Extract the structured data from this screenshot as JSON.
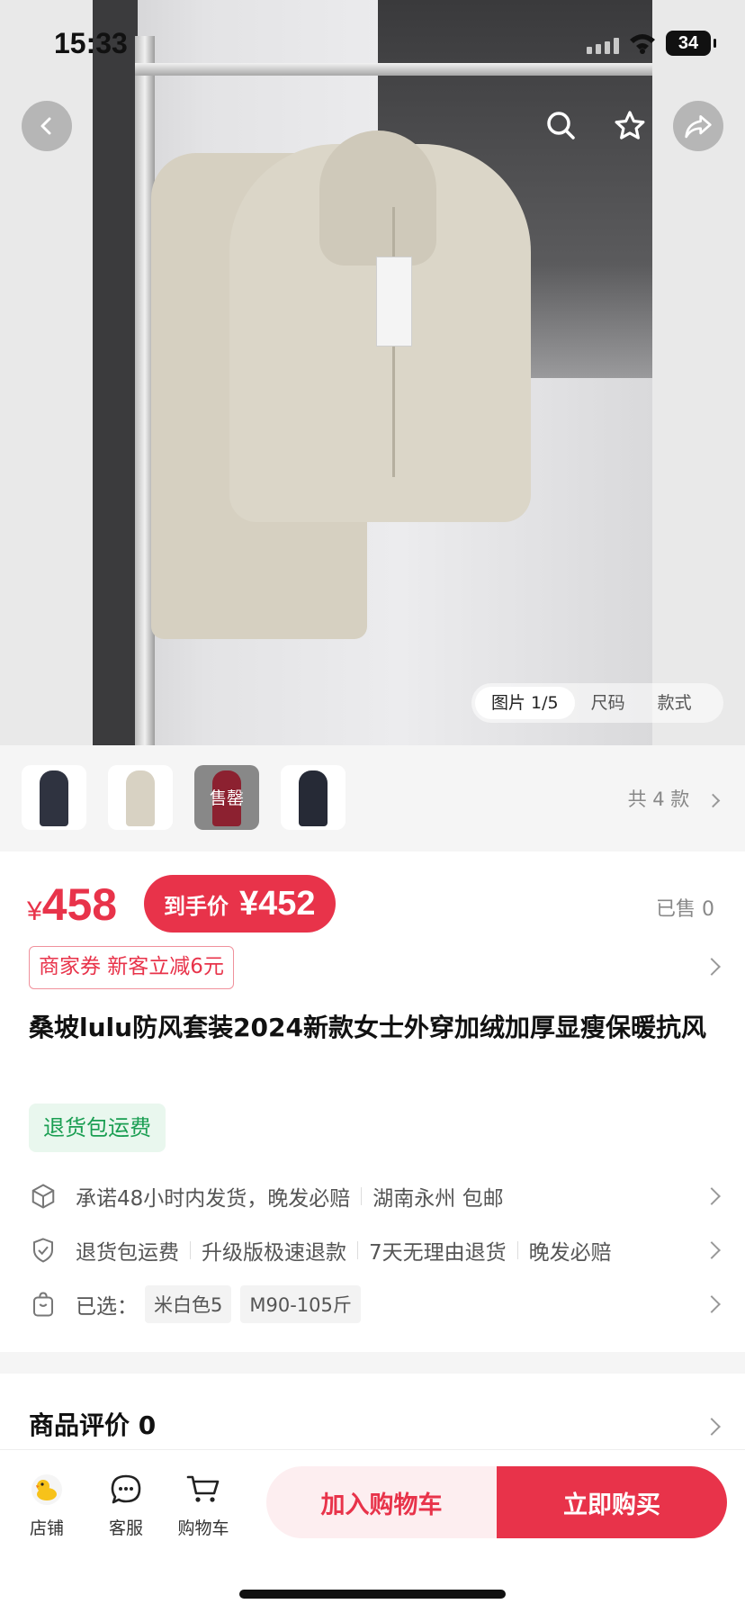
{
  "status_bar": {
    "time": "15:33",
    "battery": "34"
  },
  "media_tabs": [
    "图片 1/5",
    "尺码",
    "款式"
  ],
  "thumbnails": {
    "sold_out_label": "售罄",
    "more_label": "共 4 款"
  },
  "price": {
    "currency": "¥",
    "original": "458",
    "final_label": "到手价",
    "final_value": "¥452",
    "sold": "已售 0"
  },
  "coupon": "商家券 新客立减6元",
  "product_title": "桑坡lulu防风套装2024新款女士外穿加绒加厚显瘦保暖抗风",
  "badge": "退货包运费",
  "shipping": {
    "promise": "承诺48小时内发货，晚发必赔",
    "origin": "湖南永州 包邮"
  },
  "services": [
    "退货包运费",
    "升级版极速退款",
    "7天无理由退货",
    "晚发必赔"
  ],
  "selection": {
    "label": "已选：",
    "color": "米白色5",
    "size": "M90-105斤"
  },
  "reviews": {
    "title": "商品评价 0"
  },
  "bottom_nav": {
    "store": "店铺",
    "service": "客服",
    "cart": "购物车"
  },
  "actions": {
    "add_to_cart": "加入购物车",
    "buy_now": "立即购买"
  },
  "colors": {
    "accent": "#e8334a",
    "green": "#1a9e52"
  }
}
